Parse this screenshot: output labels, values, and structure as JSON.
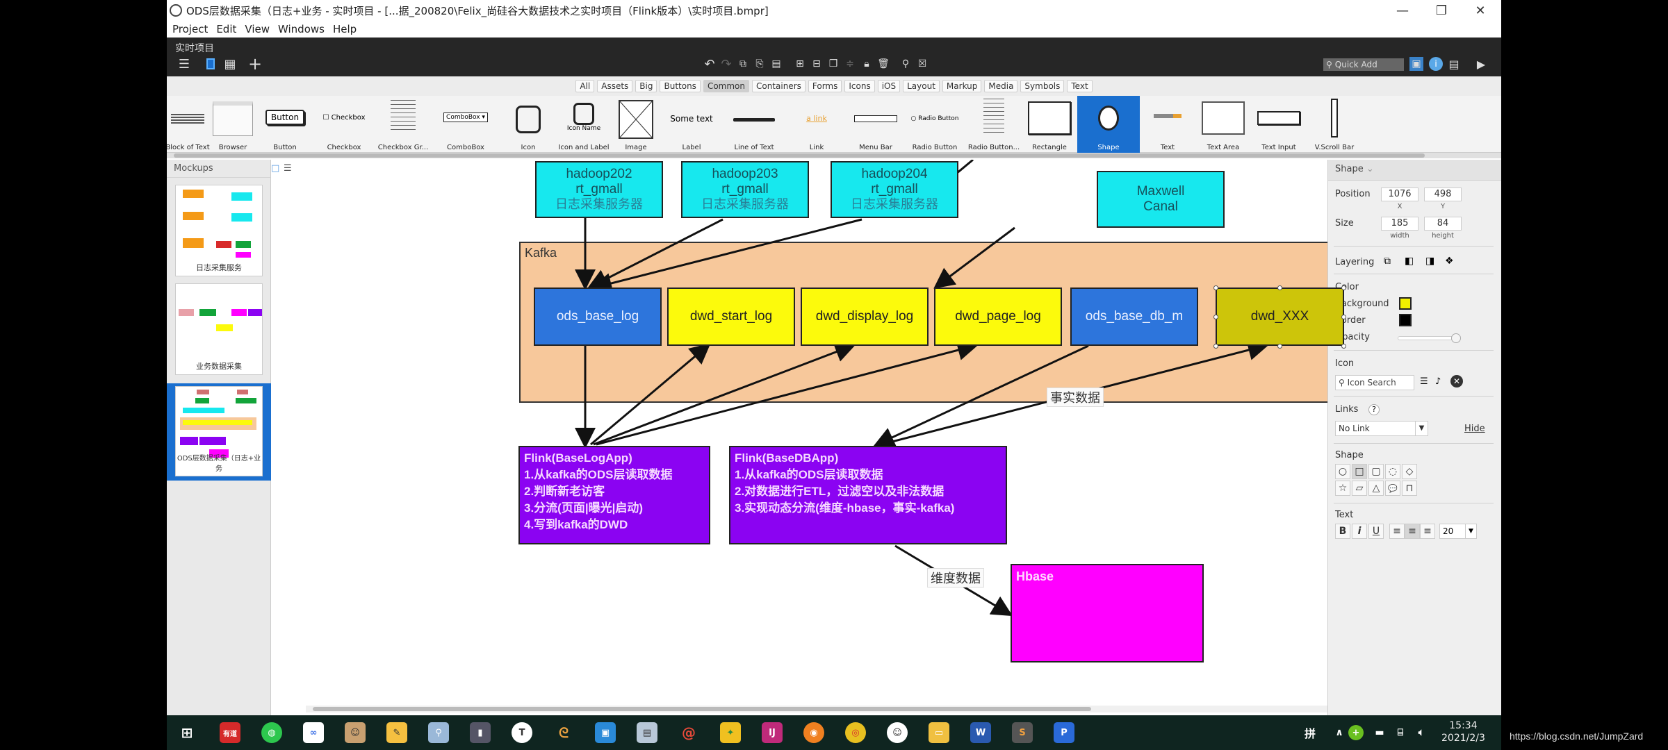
{
  "window": {
    "title": "ODS层数据采集（日志+业务 - 实时项目 - [...据_200820\\Felix_尚硅谷大数据技术之实时项目（Flink版本）\\实时项目.bmpr]",
    "controls": {
      "minimize": "—",
      "restore": "❐",
      "close": "✕"
    }
  },
  "menu": [
    "Project",
    "Edit",
    "View",
    "Windows",
    "Help"
  ],
  "toolbar": {
    "project_name": "实时项目",
    "quick_add_placeholder": "Quick Add"
  },
  "filters": {
    "tabs": [
      "All",
      "Assets",
      "Big",
      "Buttons",
      "Common",
      "Containers",
      "Forms",
      "Icons",
      "iOS",
      "Layout",
      "Markup",
      "Media",
      "Symbols",
      "Text"
    ],
    "active": "Common"
  },
  "library": {
    "items": [
      "Block of Text",
      "Browser",
      "Button",
      "Checkbox",
      "Checkbox Gr...",
      "ComboBox",
      "Icon",
      "Icon and Label",
      "Image",
      "Label",
      "Line of Text",
      "Link",
      "Menu Bar",
      "Radio Button",
      "Radio Button...",
      "Rectangle",
      "Shape",
      "Text",
      "Text Area",
      "Text Input",
      "V.Scroll Bar"
    ],
    "selected": "Shape",
    "previews": {
      "button": "Button",
      "checkbox": "Checkbox",
      "combobox": "ComboBox",
      "icon_name": "Icon Name",
      "label": "Some text",
      "link": "a link",
      "radio": "Radio Button"
    }
  },
  "mockups": {
    "header": "Mockups",
    "items": [
      {
        "label": "日志采集服务"
      },
      {
        "label": "业务数据采集"
      },
      {
        "label": "ODS层数据采集（日志+业务"
      }
    ],
    "selected_index": 2
  },
  "diagram": {
    "servers": [
      {
        "host": "hadoop202",
        "app": "rt_gmall",
        "desc": "日志采集服务器"
      },
      {
        "host": "hadoop203",
        "app": "rt_gmall",
        "desc": "日志采集服务器"
      },
      {
        "host": "hadoop204",
        "app": "rt_gmall",
        "desc": "日志采集服务器"
      }
    ],
    "cdc": {
      "line1": "Maxwell",
      "line2": "Canal"
    },
    "kafka_label": "Kafka",
    "topics": [
      {
        "name": "ods_base_log",
        "color": "#2d75dc"
      },
      {
        "name": "dwd_start_log",
        "color": "#fcfa0c"
      },
      {
        "name": "dwd_display_log",
        "color": "#fcfa0c"
      },
      {
        "name": "dwd_page_log",
        "color": "#fcfa0c"
      },
      {
        "name": "ods_base_db_m",
        "color": "#2d75dc"
      },
      {
        "name": "dwd_XXX",
        "color": "#cdc50a"
      }
    ],
    "fact_label": "事实数据",
    "dim_label": "维度数据",
    "base_log_app": {
      "title": "Flink(BaseLogApp)",
      "lines": [
        "1.从kafka的ODS层读取数据",
        "2.判断新老访客",
        "3.分流(页面|曝光|启动)",
        "4.写到kafka的DWD"
      ]
    },
    "base_db_app": {
      "title": "Flink(BaseDBApp)",
      "lines": [
        "1.从kafka的ODS层读取数据",
        "2.对数据进行ETL，过滤空以及非法数据",
        "3.实现动态分流(维度-hbase，事实-kafka)"
      ]
    },
    "hbase": {
      "title": "Hbase"
    }
  },
  "properties": {
    "header": "Shape",
    "position_label": "Position",
    "x": "1076",
    "y": "498",
    "x_label": "X",
    "y_label": "Y",
    "size_label": "Size",
    "width": "185",
    "height": "84",
    "width_label": "width",
    "height_label": "height",
    "layering_label": "Layering",
    "color_label": "Color",
    "background_label": "Background",
    "background_color": "#f2ef00",
    "border_label": "Border",
    "border_color": "#000000",
    "opacity_label": "Opacity",
    "opacity": 1.0,
    "icon_label": "Icon",
    "icon_search_placeholder": "Icon Search",
    "links_label": "Links",
    "link_value": "No Link",
    "hide_label": "Hide",
    "shape_label": "Shape",
    "shape_options": [
      "○",
      "□",
      "▢",
      "◌",
      "◇",
      "☆",
      "▱",
      "△",
      "💬",
      "⊓"
    ],
    "text_label": "Text",
    "bold": "B",
    "italic": "i",
    "underline": "U",
    "font_size": "20"
  },
  "taskbar": {
    "time": "15:34",
    "date": "2021/2/3",
    "watermark": "https://blog.csdn.net/JumpZard"
  }
}
